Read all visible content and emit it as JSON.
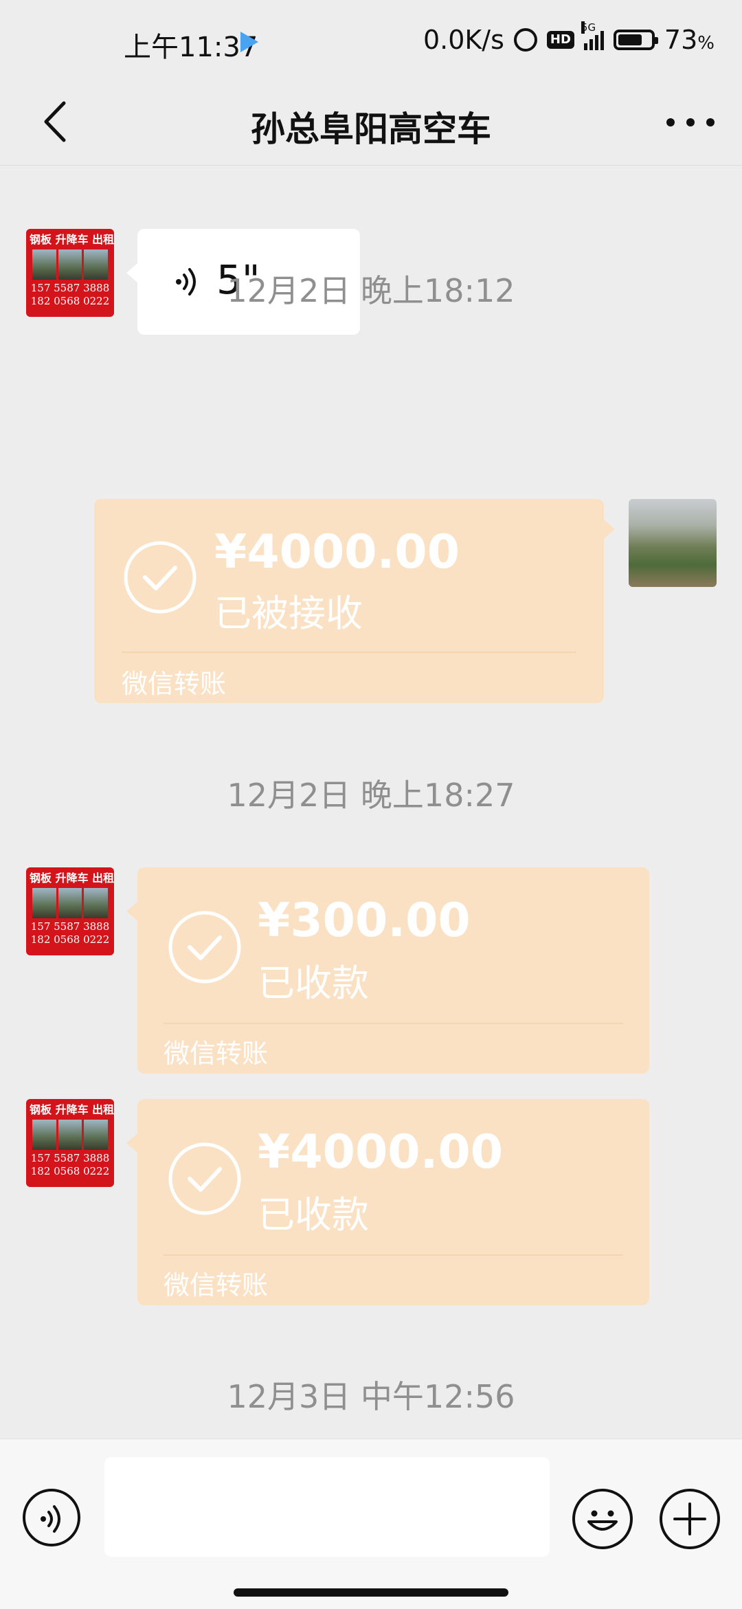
{
  "status_bar": {
    "time": "上午11:37",
    "network_speed": "0.0K/s",
    "hd_label": "HD",
    "network_type": "5G",
    "battery_percent": "73",
    "battery_unit": "%",
    "battery_level": 0.73,
    "icons": [
      "play-store-icon",
      "alarm-icon",
      "hd-icon",
      "signal-icon",
      "battery-icon"
    ]
  },
  "header": {
    "title": "孙总阜阳高空车",
    "back_icon": "chevron-left-icon",
    "more_icon": "more-dots-icon"
  },
  "contact_avatar": {
    "top_text": "钢板 升降车 出租",
    "phone_1": "157 5587 3888",
    "phone_2": "182 0568 0222",
    "accent_color": "#d4141b"
  },
  "messages": {
    "voice": {
      "duration": "5\""
    },
    "divider_1": "12月2日 晚上18:12",
    "transfer_1": {
      "amount": "¥4000.00",
      "status": "已被接收",
      "label": "微信转账"
    },
    "divider_2": "12月2日 晚上18:27",
    "transfer_2": {
      "amount": "¥300.00",
      "status": "已收款",
      "label": "微信转账"
    },
    "transfer_3": {
      "amount": "¥4000.00",
      "status": "已收款",
      "label": "微信转账"
    },
    "divider_3": "12月3日 中午12:56"
  },
  "input_bar": {
    "message_value": "",
    "icons": [
      "voice-toggle-icon",
      "emoji-icon",
      "plus-icon"
    ]
  },
  "colors": {
    "background": "#ededed",
    "transfer_bubble": "#fbe1c4",
    "divider_text": "#8f8f8f"
  }
}
